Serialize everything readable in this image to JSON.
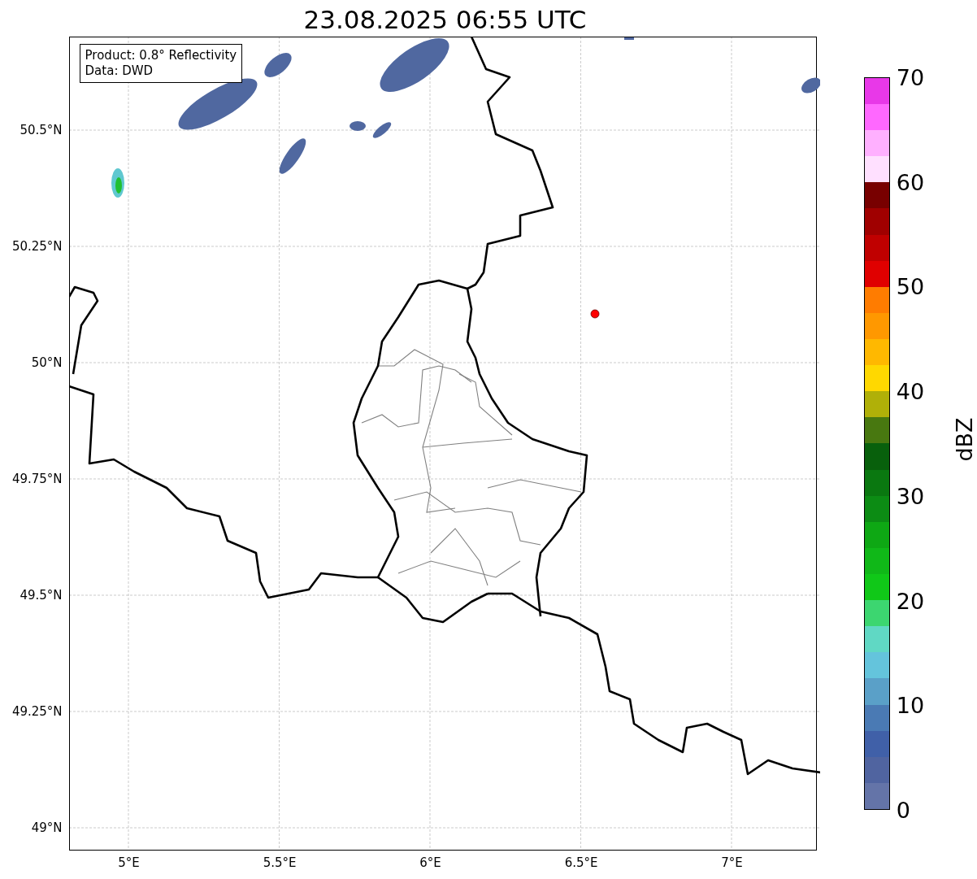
{
  "title": "23.08.2025 06:55 UTC",
  "info_box": {
    "lines": [
      "Product: 0.8° Reflectivity",
      "Data: DWD"
    ]
  },
  "map": {
    "yticks": [
      "50.5°N",
      "50.25°N",
      "50°N",
      "49.75°N",
      "49.5°N",
      "49.25°N",
      "49°N"
    ],
    "xticks": [
      "5°E",
      "5.5°E",
      "6°E",
      "6.5°E",
      "7°E"
    ]
  },
  "colorbar": {
    "label": "dBZ",
    "ticks": [
      "70",
      "60",
      "50",
      "40",
      "30",
      "20",
      "10",
      "0"
    ],
    "segments": [
      {
        "color": "#6474a8"
      },
      {
        "color": "#5064a0"
      },
      {
        "color": "#4060a8"
      },
      {
        "color": "#4a7ab4"
      },
      {
        "color": "#5aa0c8"
      },
      {
        "color": "#64c4dc"
      },
      {
        "color": "#60d8c4"
      },
      {
        "color": "#3cd670"
      },
      {
        "color": "#10c818"
      },
      {
        "color": "#10b818"
      },
      {
        "color": "#0ea814"
      },
      {
        "color": "#0c8c14"
      },
      {
        "color": "#0a7810"
      },
      {
        "color": "#08600c"
      },
      {
        "color": "#487810"
      },
      {
        "color": "#b0b008"
      },
      {
        "color": "#ffd800"
      },
      {
        "color": "#ffb800"
      },
      {
        "color": "#ff9800"
      },
      {
        "color": "#ff7c00"
      },
      {
        "color": "#e00000"
      },
      {
        "color": "#c00000"
      },
      {
        "color": "#a00000"
      },
      {
        "color": "#780000"
      },
      {
        "color": "#ffe0ff"
      },
      {
        "color": "#ffb0ff"
      },
      {
        "color": "#ff68ff"
      },
      {
        "color": "#e838e8"
      }
    ]
  }
}
